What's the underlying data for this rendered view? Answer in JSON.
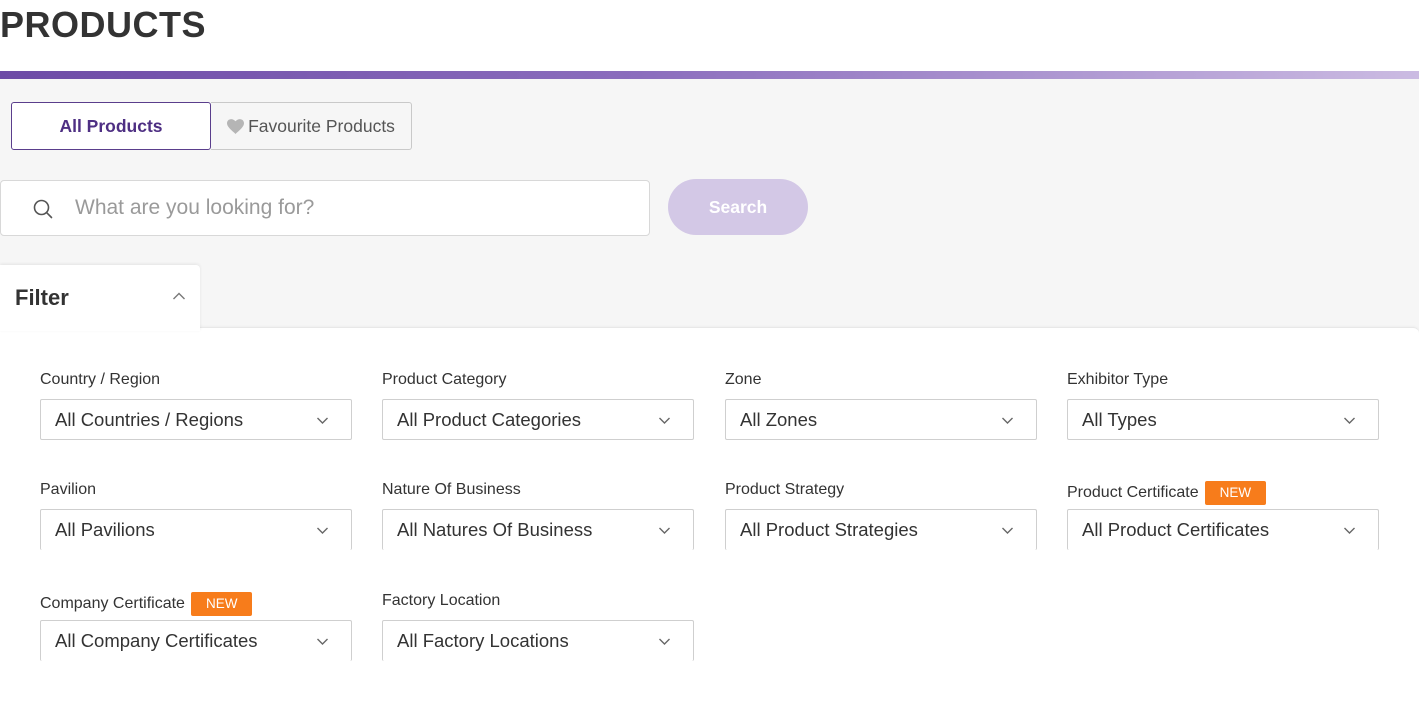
{
  "header": {
    "title": "PRODUCTS"
  },
  "tabs": [
    {
      "label": "All Products",
      "active": true
    },
    {
      "label": "Favourite Products",
      "icon": "heart-icon",
      "active": false
    }
  ],
  "search": {
    "placeholder": "What are you looking for?",
    "value": "",
    "button_label": "Search"
  },
  "filter": {
    "title": "Filter",
    "badge_label": "NEW",
    "fields": [
      {
        "label": "Country / Region",
        "value": "All Countries / Regions",
        "new": false
      },
      {
        "label": "Product Category",
        "value": "All Product Categories",
        "new": false
      },
      {
        "label": "Zone",
        "value": "All Zones",
        "new": false
      },
      {
        "label": "Exhibitor Type",
        "value": "All Types",
        "new": false
      },
      {
        "label": "Pavilion",
        "value": "All Pavilions",
        "new": false
      },
      {
        "label": "Nature Of Business",
        "value": "All Natures Of Business",
        "new": false
      },
      {
        "label": "Product Strategy",
        "value": "All Product Strategies",
        "new": false
      },
      {
        "label": "Product Certificate",
        "value": "All Product Certificates",
        "new": true
      },
      {
        "label": "Company Certificate",
        "value": "All Company Certificates",
        "new": true
      },
      {
        "label": "Factory Location",
        "value": "All Factory Locations",
        "new": false
      }
    ]
  },
  "colors": {
    "accent": "#4e2f83",
    "search_button": "#d3c8e6",
    "badge": "#f77c1b"
  }
}
